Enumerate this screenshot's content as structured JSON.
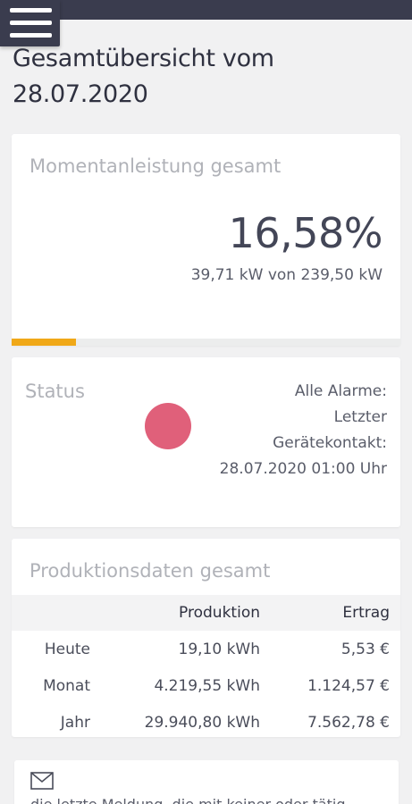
{
  "header": {
    "menu_icon": "hamburger-menu-icon",
    "title": "Gesamtübersicht vom 28.07.2020"
  },
  "momentanleistung": {
    "title": "Momentanleistung gesamt",
    "percent": "16,58%",
    "detail": "39,71 kW von 239,50 kW",
    "progress_fraction": 0.1658,
    "progress_color": "#f0a818"
  },
  "status": {
    "label": "Status",
    "indicator_color": "#e0607a",
    "line1": "Alle Alarme:",
    "line2": "Letzter",
    "line3": "Gerätekontakt:",
    "line4": "28.07.2020 01:00 Uhr"
  },
  "produktion": {
    "title": "Produktionsdaten gesamt",
    "headers": [
      "",
      "Produktion",
      "Ertrag"
    ],
    "rows": [
      [
        "Heute",
        "19,10 kWh",
        "5,53 €"
      ],
      [
        "Monat",
        "4.219,55 kWh",
        "1.124,57 €"
      ],
      [
        "Jahr",
        "29.940,80 kWh",
        "7.562,78 €"
      ]
    ]
  },
  "messages": {
    "icon": "envelope-icon",
    "text": "die letzte Meldung, die mit keiner oder tätig"
  }
}
